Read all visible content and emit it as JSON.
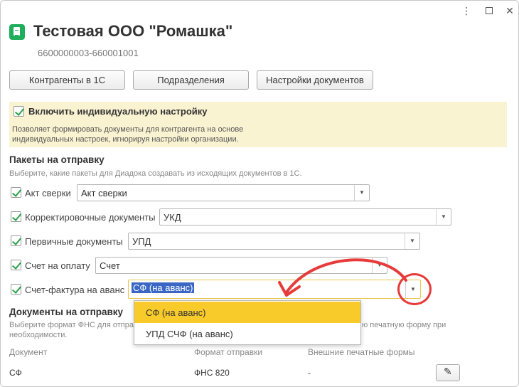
{
  "window": {
    "more_glyph": "⋮",
    "close_glyph": "✕",
    "title": "Тестовая ООО \"Ромашка\"",
    "subtitle": "6600000003-660001001"
  },
  "toolbar": {
    "counterparties_label": "Контрагенты в 1С",
    "divisions_label": "Подразделения",
    "doc_settings_label": "Настройки документов"
  },
  "individual": {
    "label": "Включить индивидуальную настройку",
    "checked": true,
    "description": "Позволяет формировать документы для контрагента на основе индивидуальных настроек, игнорируя настройки организации."
  },
  "packages": {
    "title": "Пакеты на отправку",
    "description": "Выберите, какие пакеты для Диадока создавать из исходящих документов в 1С.",
    "rows": [
      {
        "label": "Акт сверки",
        "value": "Акт сверки",
        "checked": true
      },
      {
        "label": "Корректировочные документы",
        "value": "УКД",
        "checked": true
      },
      {
        "label": "Первичные документы",
        "value": "УПД",
        "checked": true
      },
      {
        "label": "Счет на оплату",
        "value": "Счет",
        "checked": true
      },
      {
        "label": "Счет-фактура на аванс",
        "value": "СФ (на аванс)",
        "checked": true
      }
    ]
  },
  "dropdown": {
    "options": [
      "СФ (на аванс)",
      "УПД СЧФ (на аванс)"
    ],
    "selected_index": 0
  },
  "documents": {
    "title": "Документы на отправку",
    "description_left": "Выберите формат ФНС для отпра",
    "description_right": "ю печатную форму при",
    "description_line2": "необходимости.",
    "columns": [
      "Документ",
      "Формат отправки",
      "Внешние печатные формы"
    ],
    "rows": [
      {
        "document": "СФ",
        "format": "ФНС 820",
        "external": "-"
      }
    ]
  },
  "colors": {
    "accent_yellow": "#f8ca2a",
    "highlight_blue": "#3a67c3",
    "annotation_red": "#e73a3a",
    "check_green": "#2aa24a"
  }
}
